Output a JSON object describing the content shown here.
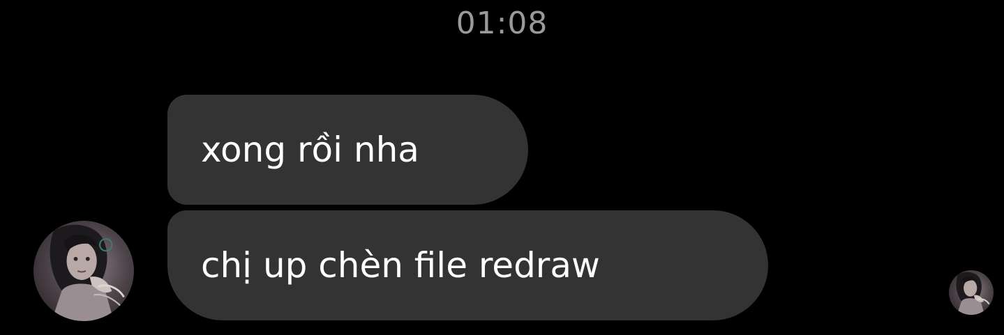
{
  "chat": {
    "timestamp": "01:08",
    "messages": [
      {
        "text": "xong rồi nha"
      },
      {
        "text": "chị up chèn file redraw"
      }
    ]
  },
  "colors": {
    "background": "#000000",
    "bubble": "#333333",
    "bubble_text": "#ffffff",
    "timestamp_text": "#9a9a9a"
  }
}
